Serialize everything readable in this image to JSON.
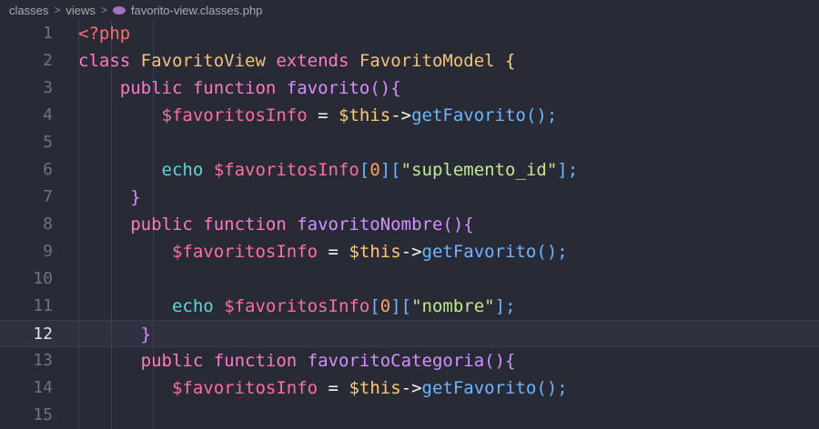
{
  "breadcrumb": {
    "parts": [
      "classes",
      "views",
      "favorito-view.classes.php"
    ],
    "separator": ">"
  },
  "editor": {
    "active_line": 12,
    "lines": [
      {
        "n": "1",
        "tokens": [
          {
            "t": "<?php",
            "c": "php"
          }
        ]
      },
      {
        "n": "2",
        "tokens": [
          {
            "t": "class ",
            "c": "kw"
          },
          {
            "t": "FavoritoView ",
            "c": "cls"
          },
          {
            "t": "extends ",
            "c": "kw"
          },
          {
            "t": "FavoritoModel ",
            "c": "cls"
          },
          {
            "t": "{",
            "c": "brk"
          }
        ]
      },
      {
        "n": "3",
        "indent": "    ",
        "tokens": [
          {
            "t": "public ",
            "c": "kw"
          },
          {
            "t": "function ",
            "c": "kw"
          },
          {
            "t": "favorito",
            "c": "fnp"
          },
          {
            "t": "(){",
            "c": "brk2"
          }
        ]
      },
      {
        "n": "4",
        "indent": "        ",
        "tokens": [
          {
            "t": "$favoritosInfo",
            "c": "var"
          },
          {
            "t": " = ",
            "c": "plain"
          },
          {
            "t": "$this",
            "c": "this"
          },
          {
            "t": "->",
            "c": "plain"
          },
          {
            "t": "getFavorito",
            "c": "fn"
          },
          {
            "t": "();",
            "c": "brk3"
          }
        ]
      },
      {
        "n": "5",
        "tokens": []
      },
      {
        "n": "6",
        "indent": "        ",
        "tokens": [
          {
            "t": "echo ",
            "c": "echo"
          },
          {
            "t": "$favoritosInfo",
            "c": "var"
          },
          {
            "t": "[",
            "c": "brk3"
          },
          {
            "t": "0",
            "c": "num"
          },
          {
            "t": "][",
            "c": "brk3"
          },
          {
            "t": "\"suplemento_id\"",
            "c": "str"
          },
          {
            "t": "];",
            "c": "brk3"
          }
        ]
      },
      {
        "n": "7",
        "indent": "     ",
        "tokens": [
          {
            "t": "}",
            "c": "brk2"
          }
        ]
      },
      {
        "n": "8",
        "indent": "     ",
        "tokens": [
          {
            "t": "public ",
            "c": "kw"
          },
          {
            "t": "function ",
            "c": "kw"
          },
          {
            "t": "favoritoNombre",
            "c": "fnp"
          },
          {
            "t": "(){",
            "c": "brk2"
          }
        ]
      },
      {
        "n": "9",
        "indent": "         ",
        "tokens": [
          {
            "t": "$favoritosInfo",
            "c": "var"
          },
          {
            "t": " = ",
            "c": "plain"
          },
          {
            "t": "$this",
            "c": "this"
          },
          {
            "t": "->",
            "c": "plain"
          },
          {
            "t": "getFavorito",
            "c": "fn"
          },
          {
            "t": "();",
            "c": "brk3"
          }
        ]
      },
      {
        "n": "10",
        "tokens": []
      },
      {
        "n": "11",
        "indent": "         ",
        "tokens": [
          {
            "t": "echo ",
            "c": "echo"
          },
          {
            "t": "$favoritosInfo",
            "c": "var"
          },
          {
            "t": "[",
            "c": "brk3"
          },
          {
            "t": "0",
            "c": "num"
          },
          {
            "t": "][",
            "c": "brk3"
          },
          {
            "t": "\"nombre\"",
            "c": "str"
          },
          {
            "t": "];",
            "c": "brk3"
          }
        ]
      },
      {
        "n": "12",
        "indent": "      ",
        "tokens": [
          {
            "t": "}",
            "c": "brk2"
          }
        ]
      },
      {
        "n": "13",
        "indent": "      ",
        "tokens": [
          {
            "t": "public ",
            "c": "kw"
          },
          {
            "t": "function ",
            "c": "kw"
          },
          {
            "t": "favoritoCategoria",
            "c": "fnp"
          },
          {
            "t": "(){",
            "c": "brk2"
          }
        ]
      },
      {
        "n": "14",
        "indent": "         ",
        "tokens": [
          {
            "t": "$favoritosInfo",
            "c": "var"
          },
          {
            "t": " = ",
            "c": "plain"
          },
          {
            "t": "$this",
            "c": "this"
          },
          {
            "t": "->",
            "c": "plain"
          },
          {
            "t": "getFavorito",
            "c": "fn"
          },
          {
            "t": "();",
            "c": "brk3"
          }
        ]
      },
      {
        "n": "15",
        "tokens": []
      }
    ]
  }
}
